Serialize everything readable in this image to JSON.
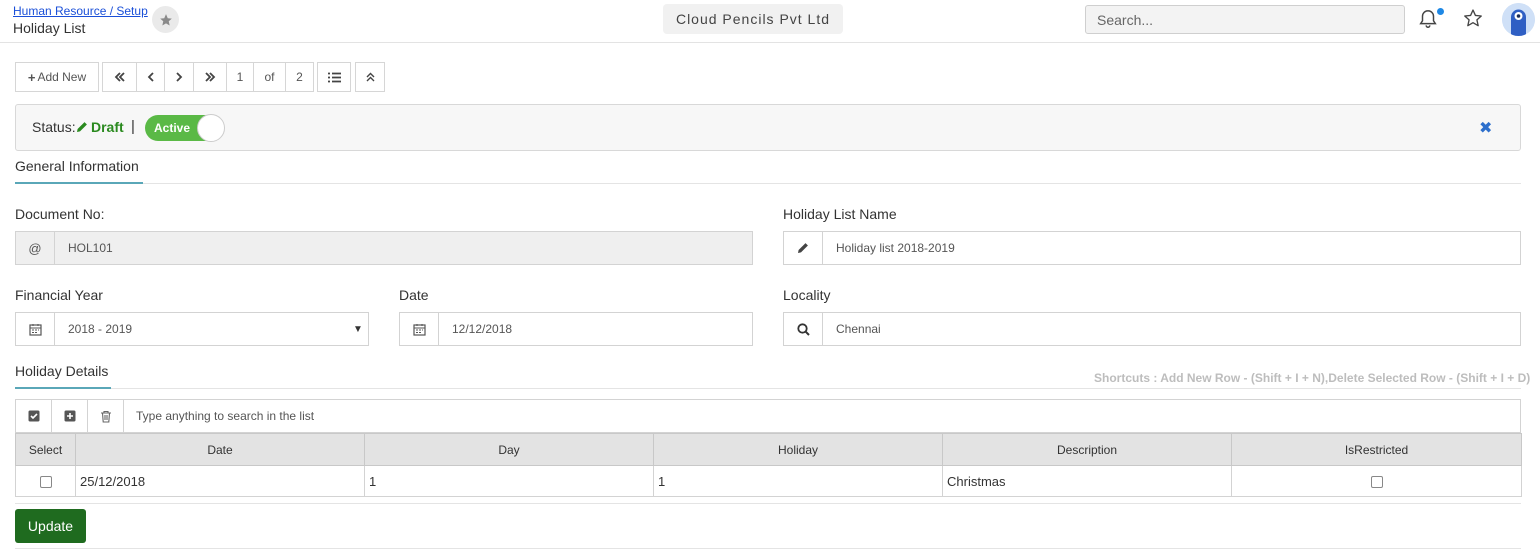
{
  "header": {
    "breadcrumb": "Human Resource / Setup",
    "title": "Holiday List",
    "company": "Cloud Pencils Pvt Ltd",
    "search_placeholder": "Search...",
    "notification_dot_color": "#1e88e5"
  },
  "toolbar": {
    "add_new_label": "Add New",
    "current_page": "1",
    "of_label": "of",
    "total_pages": "2"
  },
  "status": {
    "label": "Status:",
    "value": "Draft",
    "separator": "|",
    "toggle_label": "Active",
    "toggle_on": true,
    "toggle_color": "#5ab946",
    "draft_color": "#2a8a1f"
  },
  "sections": {
    "general": "General Information",
    "holiday_details": "Holiday Details"
  },
  "fields": {
    "document_no": {
      "label": "Document No:",
      "value": "HOL101",
      "icon": "at-icon"
    },
    "holiday_list_name": {
      "label": "Holiday List Name",
      "value": "Holiday list 2018-2019",
      "icon": "pencil-icon"
    },
    "financial_year": {
      "label": "Financial Year",
      "value": "2018 - 2019",
      "icon": "calendar-icon"
    },
    "date": {
      "label": "Date",
      "value": "12/12/2018",
      "icon": "calendar-icon"
    },
    "locality": {
      "label": "Locality",
      "value": "Chennai",
      "icon": "search-icon"
    }
  },
  "shortcuts": "Shortcuts : Add New Row - (Shift + I + N),Delete Selected Row - (Shift + I + D)",
  "grid": {
    "search_placeholder": "Type anything to search in the list",
    "columns": [
      "Select",
      "Date",
      "Day",
      "Holiday",
      "Description",
      "IsRestricted"
    ],
    "rows": [
      {
        "date": "25/12/2018",
        "day": "1",
        "holiday": "1",
        "description": "Christmas",
        "selected": false,
        "restricted": false
      }
    ]
  },
  "actions": {
    "update_label": "Update",
    "update_color": "#1f6b1f"
  }
}
